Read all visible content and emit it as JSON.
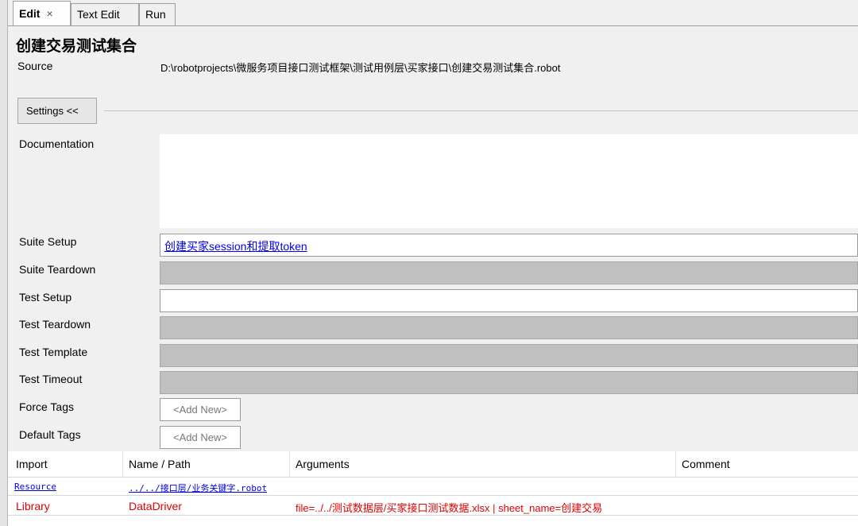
{
  "tabs": [
    {
      "label": "Edit",
      "close": "×"
    },
    {
      "label": "Text Edit"
    },
    {
      "label": "Run"
    }
  ],
  "suite": {
    "title": "创建交易测试集合",
    "source_label": "Source",
    "source_value": "D:\\robotprojects\\微服务项目接口测试框架\\测试用例层\\买家接口\\创建交易测试集合.robot"
  },
  "settings": {
    "toggle_label": "Settings <<",
    "documentation_label": "Documentation",
    "rows": [
      {
        "label": "Suite Setup",
        "value": "创建买家session和提取token"
      },
      {
        "label": "Suite Teardown",
        "value": ""
      },
      {
        "label": "Test Setup",
        "value": ""
      },
      {
        "label": "Test Teardown",
        "value": ""
      },
      {
        "label": "Test Template",
        "value": ""
      },
      {
        "label": "Test Timeout",
        "value": ""
      }
    ],
    "force_tags_label": "Force Tags",
    "default_tags_label": "Default Tags",
    "add_new": "<Add New>"
  },
  "imports": {
    "headers": [
      "Import",
      "Name / Path",
      "Arguments",
      "Comment"
    ],
    "rows": [
      {
        "type": "Resource",
        "path": "../../接口层/业务关键字.robot",
        "args": "",
        "comment": "",
        "color": "#0000ee"
      },
      {
        "type": "Library",
        "path": "DataDriver",
        "args": "file=../../测试数据层/买家接口测试数据.xlsx | sheet_name=创建交易",
        "comment": "",
        "color": "#e00000"
      }
    ]
  }
}
